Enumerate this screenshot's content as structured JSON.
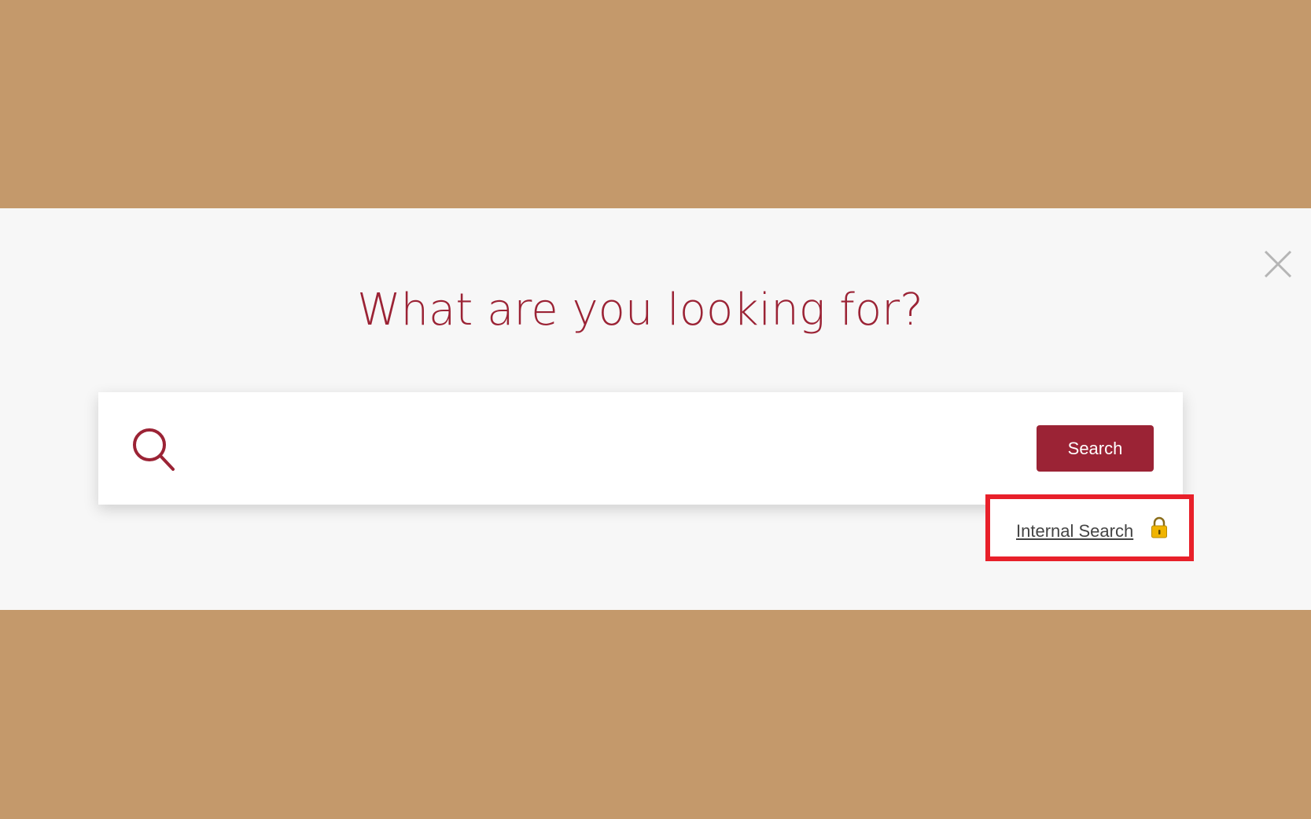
{
  "search_overlay": {
    "title": "What are you looking for?",
    "search_input": {
      "value": "",
      "placeholder": ""
    },
    "search_button_label": "Search",
    "internal_search_link": "Internal Search",
    "icons": {
      "close": "close-icon",
      "search": "search-icon",
      "lock": "lock-icon"
    },
    "colors": {
      "backdrop": "#c4996b",
      "panel": "#f7f7f7",
      "accent": "#9b2335",
      "highlight": "#e8202a",
      "lock": "#f0b400"
    }
  }
}
